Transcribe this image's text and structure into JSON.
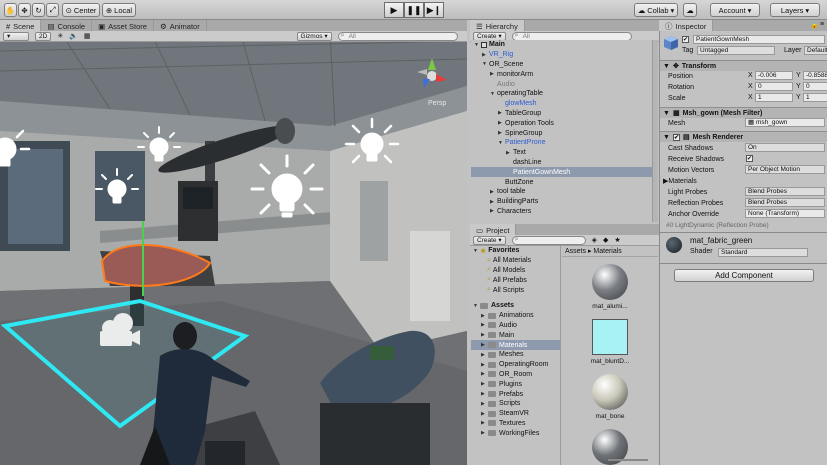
{
  "toolbar": {
    "center_label": "Center",
    "local_label": "Local",
    "collab_label": "Collab",
    "account_label": "Account",
    "layers_label": "Layers"
  },
  "scene_tabs": [
    "Scene",
    "Console",
    "Asset Store",
    "Animator"
  ],
  "scene_bar": {
    "mode": "2D",
    "gizmos": "Gizmos",
    "search_placeholder": "All",
    "persp": "Persp"
  },
  "hierarchy": {
    "tab": "Hierarchy",
    "create": "Create",
    "search_placeholder": "All",
    "items": [
      {
        "label": "Main",
        "indent": 0,
        "style": "bold",
        "arrow": "▼"
      },
      {
        "label": "VR_Rig",
        "indent": 1,
        "style": "blue",
        "arrow": "▶"
      },
      {
        "label": "OR_Scene",
        "indent": 1,
        "style": "normal",
        "arrow": "▼"
      },
      {
        "label": "monitorArm",
        "indent": 2,
        "style": "normal",
        "arrow": "▶"
      },
      {
        "label": "Audio",
        "indent": 2,
        "style": "grey",
        "arrow": ""
      },
      {
        "label": "operatingTable",
        "indent": 2,
        "style": "normal",
        "arrow": "▼"
      },
      {
        "label": "glowMesh",
        "indent": 3,
        "style": "blue",
        "arrow": ""
      },
      {
        "label": "TableGroup",
        "indent": 3,
        "style": "normal",
        "arrow": "▶"
      },
      {
        "label": "Operation Tools",
        "indent": 3,
        "style": "normal",
        "arrow": "▶"
      },
      {
        "label": "SpineGroup",
        "indent": 3,
        "style": "normal",
        "arrow": "▶"
      },
      {
        "label": "PatientProne",
        "indent": 3,
        "style": "blue",
        "arrow": "▼"
      },
      {
        "label": "Text",
        "indent": 4,
        "style": "normal",
        "arrow": "▶"
      },
      {
        "label": "dashLine",
        "indent": 4,
        "style": "normal",
        "arrow": ""
      },
      {
        "label": "PatientGownMesh",
        "indent": 4,
        "style": "selected",
        "arrow": ""
      },
      {
        "label": "ButtZone",
        "indent": 3,
        "style": "normal",
        "arrow": ""
      },
      {
        "label": "tool table",
        "indent": 2,
        "style": "normal",
        "arrow": "▶"
      },
      {
        "label": "BuildingParts",
        "indent": 2,
        "style": "normal",
        "arrow": "▶"
      },
      {
        "label": "Characters",
        "indent": 2,
        "style": "normal",
        "arrow": "▶"
      }
    ]
  },
  "project": {
    "tab": "Project",
    "create": "Create",
    "breadcrumb": "Assets ▸ Materials",
    "favorites_label": "Favorites",
    "favorites": [
      "All Materials",
      "All Models",
      "All Prefabs",
      "All Scripts"
    ],
    "assets_label": "Assets",
    "folders": [
      {
        "label": "Animations",
        "sel": false
      },
      {
        "label": "Audio",
        "sel": false
      },
      {
        "label": "Main",
        "sel": false
      },
      {
        "label": "Materials",
        "sel": true
      },
      {
        "label": "Meshes",
        "sel": false
      },
      {
        "label": "OperatingRoom",
        "sel": false
      },
      {
        "label": "OR_Room",
        "sel": false
      },
      {
        "label": "Plugins",
        "sel": false
      },
      {
        "label": "Prefabs",
        "sel": false
      },
      {
        "label": "Scripts",
        "sel": false
      },
      {
        "label": "SteamVR",
        "sel": false
      },
      {
        "label": "Textures",
        "sel": false
      },
      {
        "label": "WorkingFiles",
        "sel": false
      }
    ],
    "materials": [
      {
        "label": "mat_alumi...",
        "color": "#7b7f84"
      },
      {
        "label": "mat_bluntD...",
        "color": "#a9f2f4"
      },
      {
        "label": "mat_bone",
        "color": "#c9c7b8"
      },
      {
        "label": "",
        "color": "#6f7378"
      }
    ]
  },
  "inspector": {
    "tab": "Inspector",
    "object_name": "PatientGownMesh",
    "tag_label": "Tag",
    "tag_value": "Untagged",
    "layer_label": "Layer",
    "layer_value": "Default",
    "transform": {
      "title": "Transform",
      "position_label": "Position",
      "rotation_label": "Rotation",
      "scale_label": "Scale",
      "position": {
        "x": "-0.006",
        "y": "-0.8588"
      },
      "rotation": {
        "x": "0",
        "y": "0"
      },
      "scale": {
        "x": "1",
        "y": "1"
      }
    },
    "mesh_filter": {
      "title": "Msh_gown (Mesh Filter)",
      "mesh_label": "Mesh",
      "mesh_value": "msh_gown"
    },
    "mesh_renderer": {
      "title": "Mesh Renderer",
      "rows": [
        {
          "label": "Cast Shadows",
          "value": "On",
          "kind": "drop"
        },
        {
          "label": "Receive Shadows",
          "value": "✔",
          "kind": "check"
        },
        {
          "label": "Motion Vectors",
          "value": "Per Object Motion",
          "kind": "drop"
        },
        {
          "label": "Materials",
          "value": "",
          "kind": "fold"
        },
        {
          "label": "Light Probes",
          "value": "Blend Probes",
          "kind": "drop"
        },
        {
          "label": "Reflection Probes",
          "value": "Blend Probes",
          "kind": "drop"
        },
        {
          "label": "Anchor Override",
          "value": "None (Transform)",
          "kind": "field"
        }
      ],
      "probe_note": "#0 LightDynamic (Reflection Probe)"
    },
    "material": {
      "name": "mat_fabric_green",
      "shader_label": "Shader",
      "shader_value": "Standard"
    },
    "add_component": "Add Component"
  }
}
